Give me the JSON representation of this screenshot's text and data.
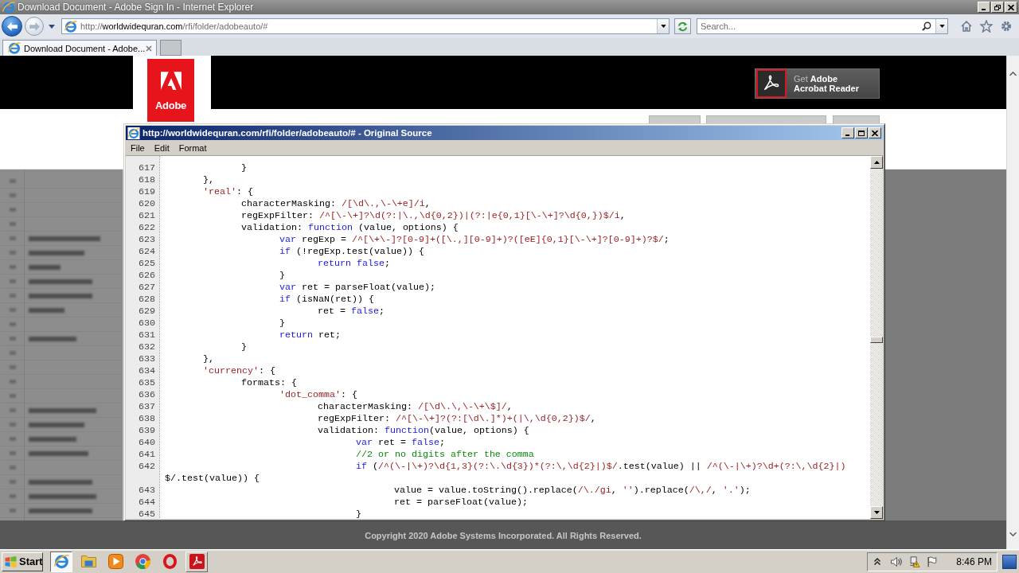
{
  "browser": {
    "title": "Download Document - Adobe Sign In - Internet Explorer",
    "nav_buttons": [
      {
        "kind": "back",
        "disabled": false
      },
      {
        "kind": "forward",
        "disabled": true
      }
    ],
    "address": "http://**worldwidequran.com**/rfi/folder/adobeauto/#",
    "search": {
      "placeholder": "Search..."
    },
    "tabs": [
      {
        "label": "Download Document - Adobe...",
        "selected": true
      }
    ]
  },
  "page": {
    "logo_text": "Adobe",
    "reader_button": {
      "lead": "Get **Adobe**",
      "product": "Acrobat Reader"
    },
    "copyright": "Copyright 2020 Adobe Systems Incorporated. All Rights Reserved."
  },
  "source_window": {
    "title": "http://worldwidequran.com/rfi/folder/adobeauto/# - Original Source",
    "menu": [
      "File",
      "Edit",
      "Format"
    ],
    "lines": [
      {
        "number": "617",
        "tokens": [
          {
            "kind": "plain",
            "text": "\t\t}"
          }
        ]
      },
      {
        "number": "618",
        "tokens": [
          {
            "kind": "plain",
            "text": "\t},"
          }
        ]
      },
      {
        "number": "619",
        "tokens": [
          {
            "kind": "literal",
            "text": "\t'real'"
          },
          {
            "kind": "plain",
            "text": ": {"
          }
        ]
      },
      {
        "number": "620",
        "tokens": [
          {
            "kind": "plain",
            "text": "\t\tcharacterMasking: "
          },
          {
            "kind": "literal",
            "text": "/[\\d\\.,\\-\\+e]/i"
          },
          {
            "kind": "plain",
            "text": ","
          }
        ]
      },
      {
        "number": "621",
        "tokens": [
          {
            "kind": "plain",
            "text": "\t\tregExpFilter: "
          },
          {
            "kind": "literal",
            "text": "/^[\\-\\+]?\\d(?:|\\.,\\d{0,2})|(?:|e{0,1}[\\-\\+]?\\d{0,})$/i"
          },
          {
            "kind": "plain",
            "text": ","
          }
        ]
      },
      {
        "number": "622",
        "tokens": [
          {
            "kind": "plain",
            "text": "\t\tvalidation: "
          },
          {
            "kind": "keyword",
            "text": "function"
          },
          {
            "kind": "plain",
            "text": " (value, options) {"
          }
        ]
      },
      {
        "number": "623",
        "tokens": [
          {
            "kind": "keyword",
            "text": "\t\t\tvar"
          },
          {
            "kind": "plain",
            "text": " regExp = "
          },
          {
            "kind": "literal",
            "text": "/^[\\+\\-]?[0-9]+([\\.,][0-9]+)?([eE]{0,1}[\\-\\+]?[0-9]+)?$/"
          },
          {
            "kind": "plain",
            "text": ";"
          }
        ]
      },
      {
        "number": "624",
        "tokens": [
          {
            "kind": "keyword",
            "text": "\t\t\tif"
          },
          {
            "kind": "plain",
            "text": " (!regExp.test(value)) {"
          }
        ]
      },
      {
        "number": "625",
        "tokens": [
          {
            "kind": "keyword",
            "text": "\t\t\t\treturn false"
          },
          {
            "kind": "plain",
            "text": ";"
          }
        ]
      },
      {
        "number": "626",
        "tokens": [
          {
            "kind": "plain",
            "text": "\t\t\t}"
          }
        ]
      },
      {
        "number": "627",
        "tokens": [
          {
            "kind": "keyword",
            "text": "\t\t\tvar"
          },
          {
            "kind": "plain",
            "text": " ret = parseFloat(value);"
          }
        ]
      },
      {
        "number": "628",
        "tokens": [
          {
            "kind": "keyword",
            "text": "\t\t\tif"
          },
          {
            "kind": "plain",
            "text": " (isNaN(ret)) {"
          }
        ]
      },
      {
        "number": "629",
        "tokens": [
          {
            "kind": "plain",
            "text": "\t\t\t\tret = "
          },
          {
            "kind": "keyword",
            "text": "false"
          },
          {
            "kind": "plain",
            "text": ";"
          }
        ]
      },
      {
        "number": "630",
        "tokens": [
          {
            "kind": "plain",
            "text": "\t\t\t}"
          }
        ]
      },
      {
        "number": "631",
        "tokens": [
          {
            "kind": "keyword",
            "text": "\t\t\treturn"
          },
          {
            "kind": "plain",
            "text": " ret;"
          }
        ]
      },
      {
        "number": "632",
        "tokens": [
          {
            "kind": "plain",
            "text": "\t\t}"
          }
        ]
      },
      {
        "number": "633",
        "tokens": [
          {
            "kind": "plain",
            "text": "\t},"
          }
        ]
      },
      {
        "number": "634",
        "tokens": [
          {
            "kind": "literal",
            "text": "\t'currency'"
          },
          {
            "kind": "plain",
            "text": ": {"
          }
        ]
      },
      {
        "number": "635",
        "tokens": [
          {
            "kind": "plain",
            "text": "\t\tformats: {"
          }
        ]
      },
      {
        "number": "636",
        "tokens": [
          {
            "kind": "literal",
            "text": "\t\t\t'dot_comma'"
          },
          {
            "kind": "plain",
            "text": ": {"
          }
        ]
      },
      {
        "number": "637",
        "tokens": [
          {
            "kind": "plain",
            "text": "\t\t\t\tcharacterMasking: "
          },
          {
            "kind": "literal",
            "text": "/[\\d\\.\\,\\-\\+\\$]/"
          },
          {
            "kind": "plain",
            "text": ","
          }
        ]
      },
      {
        "number": "638",
        "tokens": [
          {
            "kind": "plain",
            "text": "\t\t\t\tregExpFilter: "
          },
          {
            "kind": "literal",
            "text": "/^[\\-\\+]?(?:[\\d\\.]*)+(|\\,\\d{0,2})$/"
          },
          {
            "kind": "plain",
            "text": ","
          }
        ]
      },
      {
        "number": "639",
        "tokens": [
          {
            "kind": "plain",
            "text": "\t\t\t\tvalidation: "
          },
          {
            "kind": "keyword",
            "text": "function"
          },
          {
            "kind": "plain",
            "text": "(value, options) {"
          }
        ]
      },
      {
        "number": "640",
        "tokens": [
          {
            "kind": "keyword",
            "text": "\t\t\t\t\tvar"
          },
          {
            "kind": "plain",
            "text": " ret = "
          },
          {
            "kind": "keyword",
            "text": "false"
          },
          {
            "kind": "plain",
            "text": ";"
          }
        ]
      },
      {
        "number": "641",
        "tokens": [
          {
            "kind": "comment",
            "text": "\t\t\t\t\t//2 or no digits after the comma"
          }
        ]
      },
      {
        "number": "642",
        "tokens": [
          {
            "kind": "keyword",
            "text": "\t\t\t\t\tif"
          },
          {
            "kind": "plain",
            "text": " ("
          },
          {
            "kind": "literal",
            "text": "/^(\\-|\\+)?\\d{1,3}(?:\\.\\d{3})*(?:\\,\\d{2}|)$/"
          },
          {
            "kind": "plain",
            "text": ".test(value) || "
          },
          {
            "kind": "literal",
            "text": "/^(\\-|\\+)?\\d+(?:\\,\\d{2}|)"
          },
          {
            "kind": "plain",
            "text": "$/.test(value)) {"
          }
        ]
      },
      {
        "number": "643",
        "tokens": [
          {
            "kind": "plain",
            "text": "\t\t\t\t\t\tvalue = value.toString().replace("
          },
          {
            "kind": "literal",
            "text": "/\\./gi"
          },
          {
            "kind": "plain",
            "text": ", "
          },
          {
            "kind": "literal",
            "text": "''"
          },
          {
            "kind": "plain",
            "text": ").replace("
          },
          {
            "kind": "literal",
            "text": "/\\,/"
          },
          {
            "kind": "plain",
            "text": ", "
          },
          {
            "kind": "literal",
            "text": "'.'"
          },
          {
            "kind": "plain",
            "text": ");"
          }
        ]
      },
      {
        "number": "644",
        "tokens": [
          {
            "kind": "plain",
            "text": "\t\t\t\t\t\tret = parseFloat(value);"
          }
        ]
      },
      {
        "number": "645",
        "tokens": [
          {
            "kind": "plain",
            "text": "\t\t\t\t\t}"
          }
        ]
      }
    ]
  },
  "taskbar": {
    "start": "Start",
    "apps": [
      {
        "kind": "browser",
        "selected": true,
        "raised": false
      },
      {
        "kind": "folder",
        "selected": false,
        "raised": false
      },
      {
        "kind": "player",
        "selected": false,
        "raised": false
      },
      {
        "kind": "wheel",
        "selected": false,
        "raised": false
      },
      {
        "kind": "ring",
        "selected": false,
        "raised": false
      },
      {
        "kind": "reader",
        "selected": false,
        "raised": true
      }
    ],
    "clock": "8:46 PM"
  }
}
